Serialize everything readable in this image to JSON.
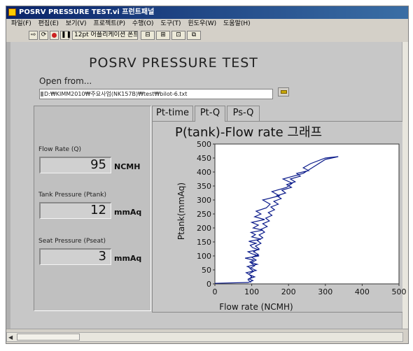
{
  "window": {
    "title": "POSRV PRESSURE TEST.vi 프런트패널",
    "menus": [
      "파일(F)",
      "편집(E)",
      "보기(V)",
      "프로젝트(P)",
      "수행(O)",
      "도구(T)",
      "윈도우(W)",
      "도움말(H)"
    ],
    "toolbar": {
      "font_select": "12pt 어플리케이션 폰트"
    }
  },
  "panel": {
    "title": "POSRV PRESSURE TEST",
    "open_label": "Open from...",
    "path_value": "D:₩KIMM2010₩주요사업(NK157B)₩test₩bilot-6.txt"
  },
  "indicators": [
    {
      "label": "Flow Rate (Q)",
      "value": "95",
      "unit": "NCMH"
    },
    {
      "label": "Tank Pressure (Ptank)",
      "value": "12",
      "unit": "mmAq"
    },
    {
      "label": "Seat Pressure (Pseat)",
      "value": "3",
      "unit": "mmAq"
    }
  ],
  "tabs": [
    {
      "label": "Pt-time",
      "active": false
    },
    {
      "label": "Pt-Q",
      "active": true
    },
    {
      "label": "Ps-Q",
      "active": false
    }
  ],
  "colors": {
    "plot_bg": "#ffffff",
    "grid": "#c8c800",
    "series": "#0a1a8a"
  },
  "chart_data": {
    "type": "line",
    "title": "P(tank)-Flow rate 그래프",
    "xlabel": "Flow rate (NCMH)",
    "ylabel": "Ptank(mmAq)",
    "xlim": [
      0,
      500
    ],
    "ylim": [
      0,
      500
    ],
    "xticks": [
      "0",
      "100",
      "200",
      "300",
      "400",
      "500"
    ],
    "yticks": [
      "0",
      "50",
      "100",
      "150",
      "200",
      "250",
      "300",
      "350",
      "400",
      "450",
      "500"
    ],
    "grid": true,
    "series": [
      {
        "x": [
          0,
          90,
          103,
          92,
          108,
          95,
          85,
          112,
          100,
          88,
          115,
          95,
          105,
          82,
          120,
          100,
          90,
          118,
          102,
          96,
          112,
          92,
          125,
          100,
          110,
          98,
          130,
          104,
          118,
          100,
          135,
          108,
          125,
          112,
          140,
          150,
          130,
          175,
          155,
          195,
          210,
          185,
          240,
          270,
          300,
          335,
          300,
          260,
          240,
          255,
          222,
          232,
          205,
          218,
          195,
          208,
          182,
          192,
          168,
          180,
          160,
          172,
          152,
          162,
          145,
          155,
          138,
          148,
          130,
          142,
          125,
          135,
          120,
          130,
          115,
          125,
          110,
          120,
          105,
          118,
          100,
          112,
          98,
          108,
          95,
          105,
          92,
          100,
          90,
          98
        ],
        "y": [
          2,
          5,
          12,
          18,
          25,
          32,
          40,
          48,
          55,
          62,
          70,
          78,
          85,
          92,
          100,
          108,
          115,
          122,
          130,
          138,
          145,
          152,
          160,
          168,
          176,
          184,
          192,
          200,
          210,
          220,
          230,
          240,
          250,
          260,
          272,
          285,
          300,
          315,
          330,
          345,
          360,
          375,
          395,
          420,
          445,
          455,
          450,
          430,
          415,
          405,
          395,
          385,
          375,
          365,
          355,
          345,
          335,
          325,
          315,
          305,
          295,
          285,
          275,
          265,
          255,
          245,
          235,
          225,
          215,
          205,
          195,
          185,
          175,
          165,
          155,
          145,
          135,
          125,
          115,
          105,
          95,
          85,
          75,
          65,
          55,
          45,
          35,
          25,
          15,
          5
        ]
      }
    ]
  }
}
